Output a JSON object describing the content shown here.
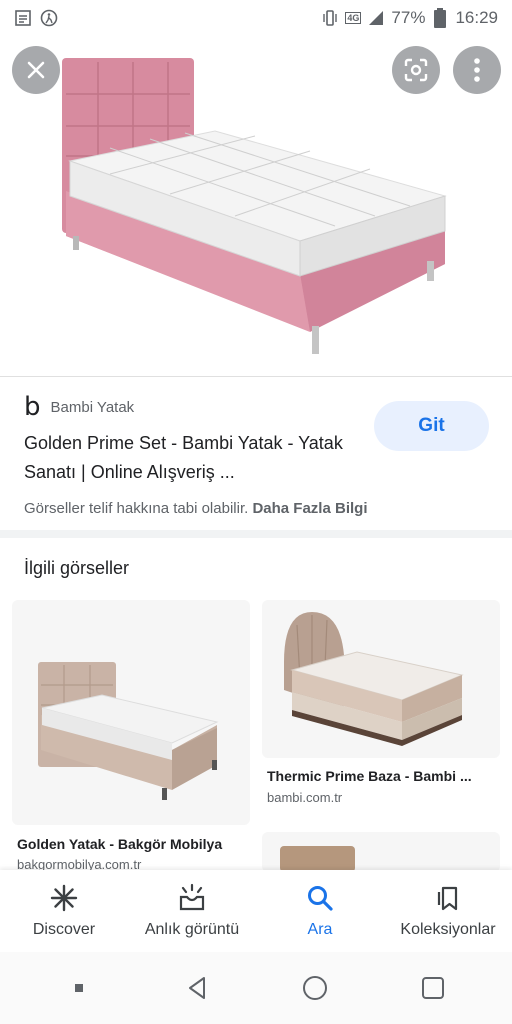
{
  "status_bar": {
    "battery": "77%",
    "time": "16:29",
    "network": "4G"
  },
  "hero": {
    "close_icon": "close-icon",
    "lens_icon": "lens-icon",
    "more_icon": "more-vert-icon"
  },
  "source": {
    "logo": "b",
    "name": "Bambi Yatak",
    "title": "Golden Prime Set - Bambi Yatak - Yatak Sanatı | Online Alışveriş ...",
    "visit_label": "Git",
    "copyright": "Görseller telif hakkına tabi olabilir.",
    "more_info": "Daha Fazla Bilgi"
  },
  "related": {
    "heading": "İlgili görseller",
    "items": [
      {
        "title": "Golden Yatak - Bakgör Mobilya",
        "source": "bakgormobilya.com.tr"
      },
      {
        "title": "Thermic Prime Baza - Bambi ...",
        "source": "bambi.com.tr"
      }
    ]
  },
  "bottom_nav": [
    {
      "label": "Discover",
      "icon": "asterisk-icon",
      "active": false
    },
    {
      "label": "Anlık görüntü",
      "icon": "snapshot-icon",
      "active": false
    },
    {
      "label": "Ara",
      "icon": "search-icon",
      "active": true
    },
    {
      "label": "Koleksiyonlar",
      "icon": "collections-icon",
      "active": false
    }
  ],
  "colors": {
    "accent": "#1a73e8",
    "headboard_pink": "#d98ea0",
    "git_bg": "#e8f0fe"
  }
}
